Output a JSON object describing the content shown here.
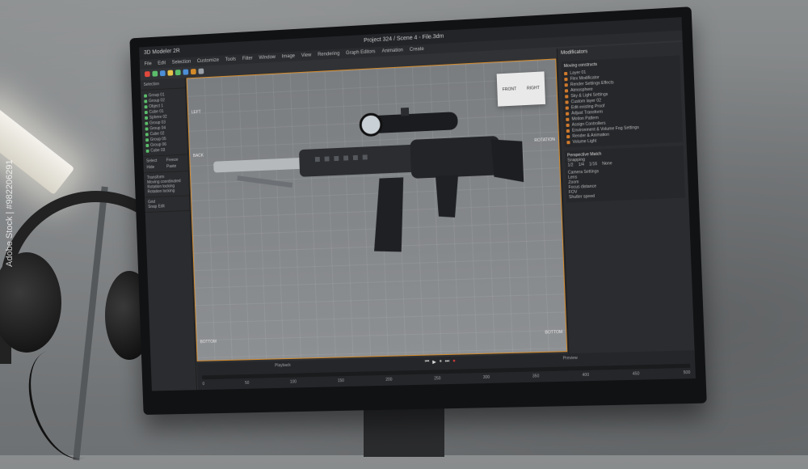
{
  "window": {
    "title": "Project 324 / Scene 4 - File.3dm",
    "app_name": "3D Modeler 2R"
  },
  "menu": [
    "File",
    "Edit",
    "Selection",
    "Customize",
    "Tools",
    "Filter",
    "Window",
    "Image",
    "View",
    "Rendering",
    "Graph Editors",
    "Animation",
    "Create"
  ],
  "viewport": {
    "navcube": {
      "front": "FRONT",
      "right": "RIGHT"
    },
    "labels": {
      "left": "LEFT",
      "bottom": "BOTTOM",
      "rotation": "ROTATION",
      "back": "BACK"
    }
  },
  "right_panel": {
    "title": "Modificators",
    "section": "Moving constructs",
    "modifiers": [
      "Layer 01",
      "Flex Modificator",
      "Render Settings Effects",
      "Atmosphere",
      "Sky & Light Settings",
      "Custom layer 02",
      "Edit existing Proof",
      "Adjust Transform",
      "Motion Pattern",
      "Assign Controllers",
      "Environment & Volume Fog Settings",
      "Render & Animation",
      "Volume Light"
    ],
    "match_title": "Perspective Match",
    "snapping_label": "Snapping",
    "snap_options": [
      "1/2",
      "1/4",
      "1/16",
      "None"
    ],
    "camera_settings_label": "Camera Settings",
    "camera_fields": [
      "Lens",
      "Zoom",
      "Focus distance",
      "FOV",
      "Shutter speed"
    ]
  },
  "left_panel": {
    "header": "Selection",
    "items": [
      "Group 01",
      "Group 02",
      "Object 1",
      "Cube 01",
      "Sphere 02",
      "Group 03",
      "Group 04",
      "Cube 02",
      "Group 05",
      "Group 06",
      "Cube 03"
    ],
    "buttons": [
      "Select",
      "Freeze",
      "Hide",
      "Paste"
    ],
    "transform_label": "Transform",
    "transform_items": [
      "Moving coordinated",
      "Rotation locking",
      "Rotation locking"
    ],
    "bottom": [
      "Grid",
      "Snap Edit"
    ]
  },
  "timeline": {
    "label": "Playback",
    "preview": "Preview",
    "ticks": [
      "0",
      "50",
      "100",
      "150",
      "200",
      "250",
      "300",
      "350",
      "400",
      "450",
      "500"
    ]
  },
  "watermark": "Adobe Stock | #982206291",
  "colors": {
    "accent": "#d48a2a",
    "ui_bg": "#2e3033",
    "viewport": "#85888b"
  }
}
